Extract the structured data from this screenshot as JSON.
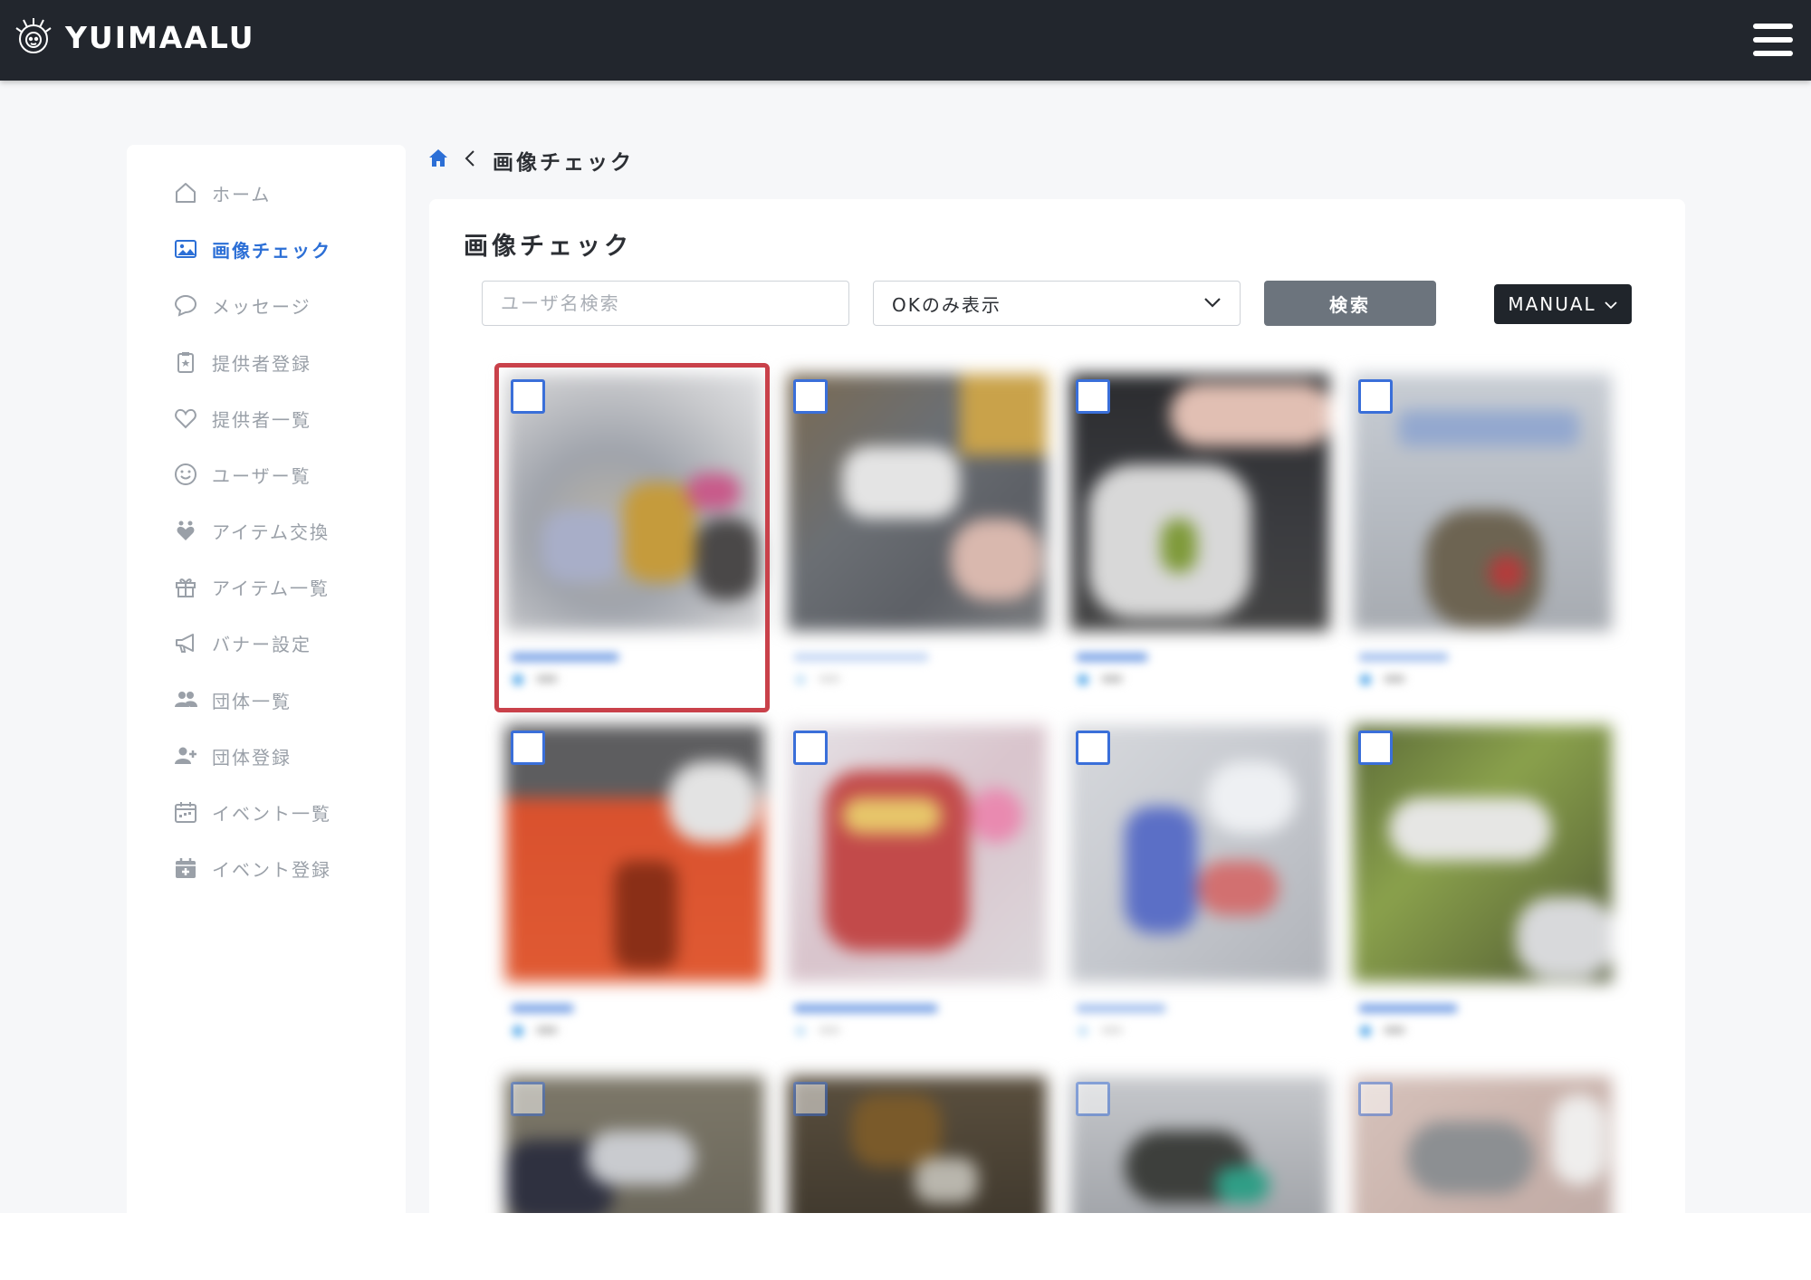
{
  "header": {
    "brand": "YUIMAALU"
  },
  "sidebar": {
    "items": [
      {
        "label": "ホーム",
        "icon": "home-icon"
      },
      {
        "label": "画像チェック",
        "icon": "image-icon",
        "active": true
      },
      {
        "label": "メッセージ",
        "icon": "message-icon"
      },
      {
        "label": "提供者登録",
        "icon": "register-icon"
      },
      {
        "label": "提供者一覧",
        "icon": "heart-icon"
      },
      {
        "label": "ユーザー覧",
        "icon": "smile-icon"
      },
      {
        "label": "アイテム交換",
        "icon": "exchange-icon"
      },
      {
        "label": "アイテム一覧",
        "icon": "gift-icon"
      },
      {
        "label": "バナー設定",
        "icon": "megaphone-icon"
      },
      {
        "label": "団体一覧",
        "icon": "group-icon"
      },
      {
        "label": "団体登録",
        "icon": "user-plus-icon"
      },
      {
        "label": "イベント一覧",
        "icon": "calendar-icon"
      },
      {
        "label": "イベント登録",
        "icon": "calendar-plus-icon"
      }
    ]
  },
  "breadcrumb": {
    "current": "画像チェック"
  },
  "main": {
    "title": "画像チェック",
    "search": {
      "placeholder": "ユーザ名検索",
      "value": ""
    },
    "filter": {
      "selected": "OKのみ表示"
    },
    "search_button": "検索",
    "mode_button": "MANUAL"
  },
  "colors": {
    "accent": "#2c6fd6",
    "topbar": "#22262d",
    "selected_border": "#c9414a"
  }
}
